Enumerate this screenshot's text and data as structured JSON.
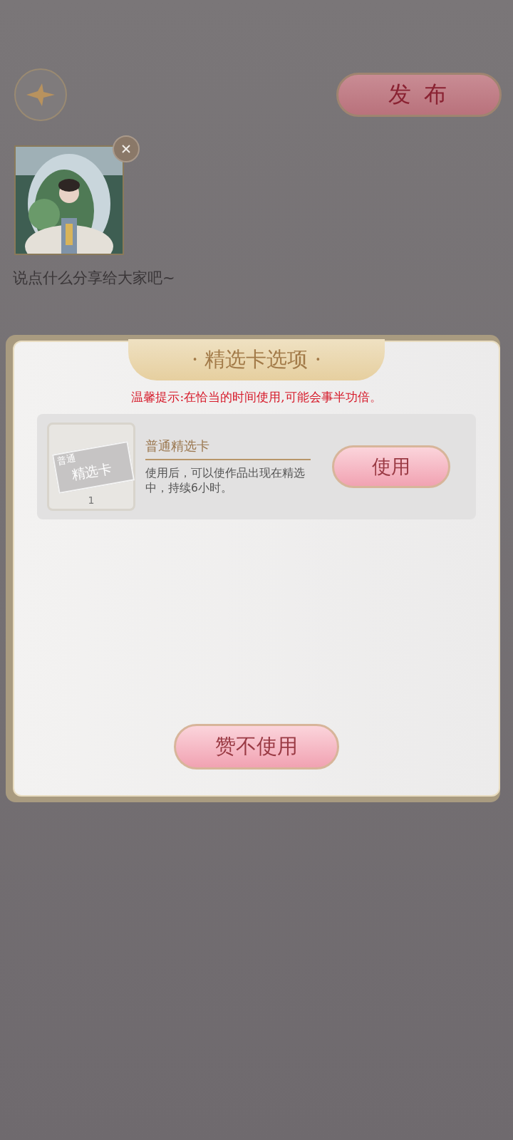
{
  "header": {
    "publish_button": "发 布"
  },
  "post": {
    "placeholder": "说点什么分享给大家吧~"
  },
  "dialog": {
    "title": "· 精选卡选项 ·",
    "tip": "温馨提示:在恰当的时间使用,可能会事半功倍。",
    "items": [
      {
        "card_label_top": "普通",
        "card_label_main": "精选卡",
        "count": "1",
        "name": "普通精选卡",
        "description": "使用后，可以使作品出现在精选中，持续6小时。",
        "button": "使用"
      }
    ],
    "decline_button": "赞不使用"
  }
}
